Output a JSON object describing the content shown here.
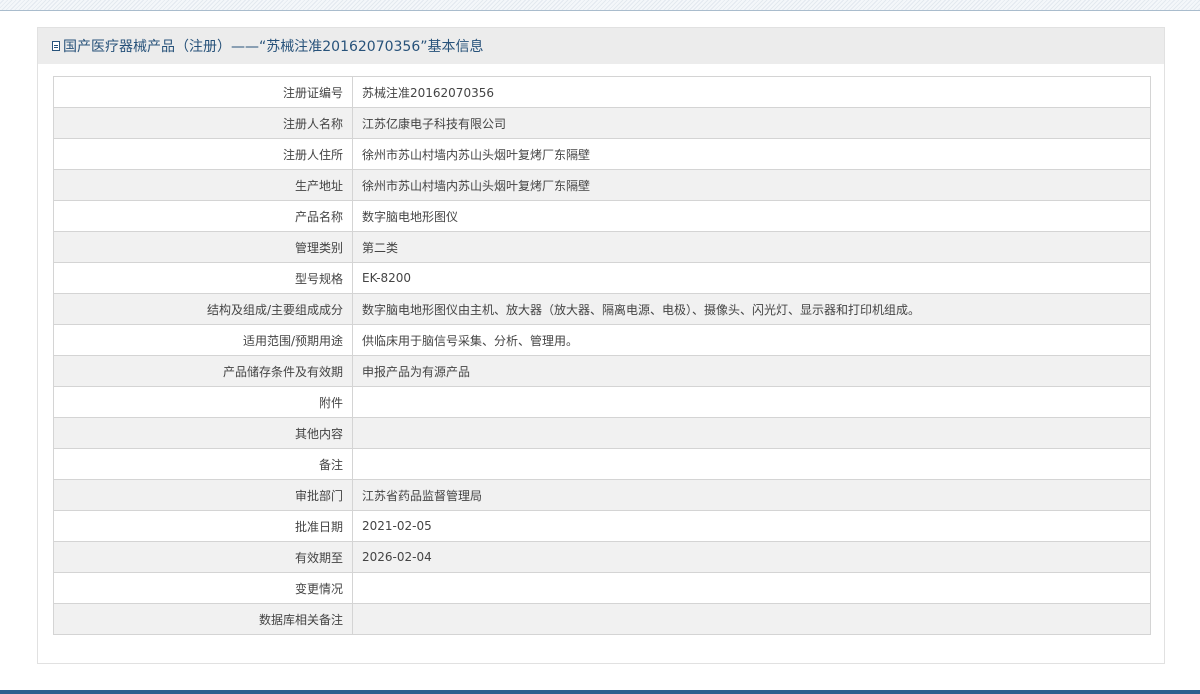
{
  "header": {
    "icon": "document-icon",
    "title": "国产医疗器械产品（注册）——“苏械注准20162070356”基本信息"
  },
  "rows": [
    {
      "label": "注册证编号",
      "value": "苏械注准20162070356"
    },
    {
      "label": "注册人名称",
      "value": "江苏亿康电子科技有限公司"
    },
    {
      "label": "注册人住所",
      "value": "徐州市苏山村墙内苏山头烟叶复烤厂东隔壁"
    },
    {
      "label": "生产地址",
      "value": "徐州市苏山村墙内苏山头烟叶复烤厂东隔壁"
    },
    {
      "label": "产品名称",
      "value": "数字脑电地形图仪"
    },
    {
      "label": "管理类别",
      "value": "第二类"
    },
    {
      "label": "型号规格",
      "value": "EK-8200"
    },
    {
      "label": "结构及组成/主要组成成分",
      "value": "数字脑电地形图仪由主机、放大器（放大器、隔离电源、电极）、摄像头、闪光灯、显示器和打印机组成。"
    },
    {
      "label": "适用范围/预期用途",
      "value": "供临床用于脑信号采集、分析、管理用。"
    },
    {
      "label": "产品储存条件及有效期",
      "value": "申报产品为有源产品"
    },
    {
      "label": "附件",
      "value": ""
    },
    {
      "label": "其他内容",
      "value": ""
    },
    {
      "label": "备注",
      "value": ""
    },
    {
      "label": "审批部门",
      "value": "江苏省药品监督管理局"
    },
    {
      "label": "批准日期",
      "value": "2021-02-05"
    },
    {
      "label": "有效期至",
      "value": "2026-02-04"
    },
    {
      "label": "变更情况",
      "value": ""
    },
    {
      "label": "数据库相关备注",
      "value": ""
    }
  ]
}
